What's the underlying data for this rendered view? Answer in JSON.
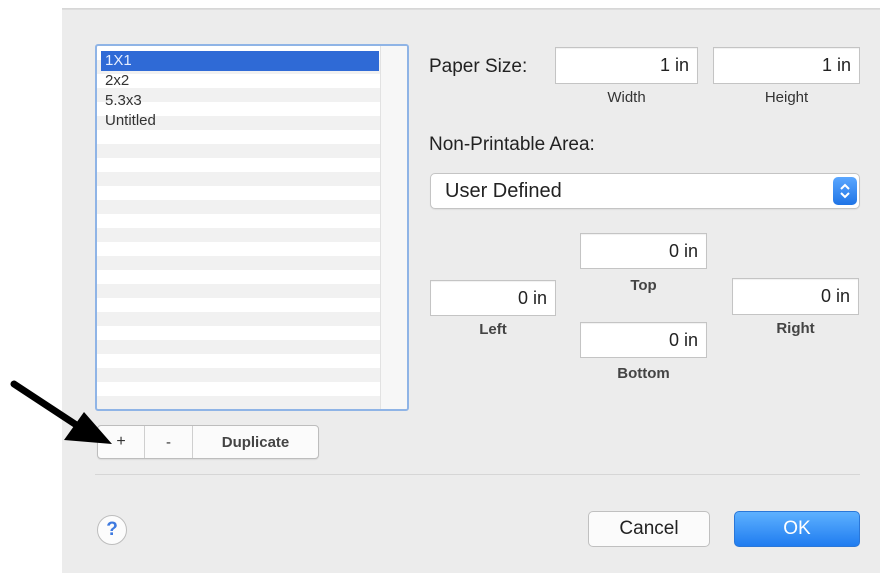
{
  "list": {
    "items": [
      "1X1",
      "2x2",
      "5.3x3",
      "Untitled"
    ],
    "selected_index": 0
  },
  "list_controls": {
    "add_label": "+",
    "remove_label": "-",
    "duplicate_label": "Duplicate"
  },
  "paper_size": {
    "label": "Paper Size:",
    "width_value": "1 in",
    "width_label": "Width",
    "height_value": "1 in",
    "height_label": "Height"
  },
  "non_printable": {
    "label": "Non-Printable Area:",
    "selected_option": "User Defined",
    "top_value": "0 in",
    "top_label": "Top",
    "left_value": "0 in",
    "left_label": "Left",
    "right_value": "0 in",
    "right_label": "Right",
    "bottom_value": "0 in",
    "bottom_label": "Bottom"
  },
  "footer": {
    "help_label": "?",
    "cancel_label": "Cancel",
    "ok_label": "OK"
  },
  "colors": {
    "accent": "#2f6ad6",
    "ok_button": "#1f7cf0",
    "dialog_bg": "#ececec"
  }
}
